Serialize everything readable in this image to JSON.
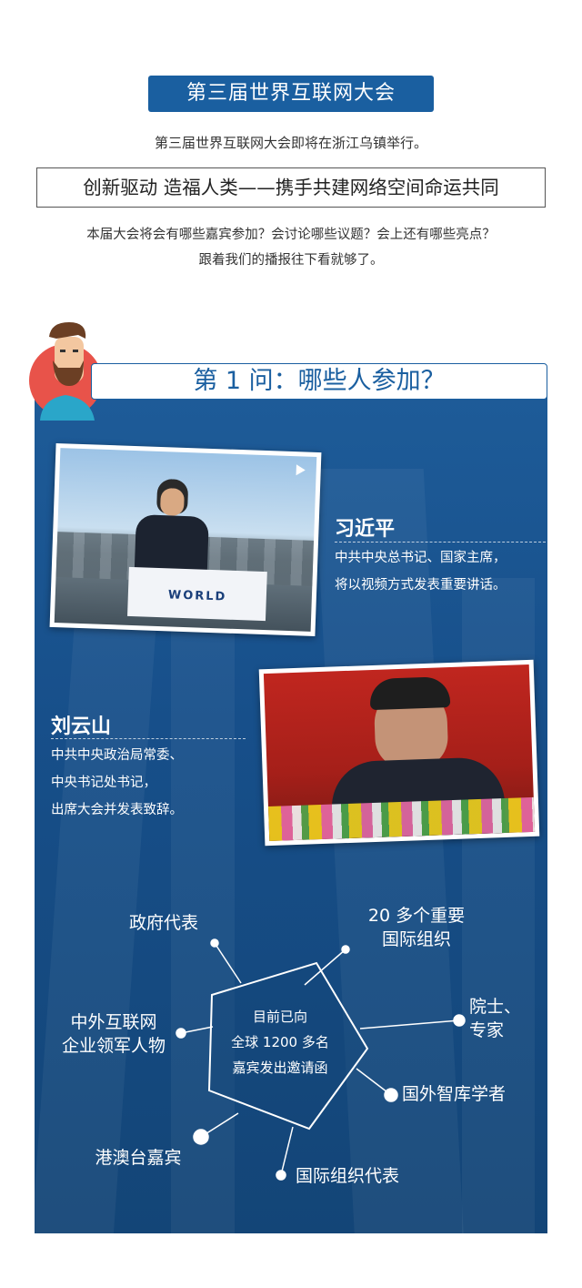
{
  "header": {
    "title": "第三届世界互联网大会",
    "intro": "第三届世界互联网大会即将在浙江乌镇举行。",
    "slogan": "创新驱动 造福人类——携手共建网络空间命运共同",
    "desc_line1": "本届大会将会有哪些嘉宾参加？会讨论哪些议题？会上还有哪些亮点？",
    "desc_line2": "跟着我们的播报往下看就够了。"
  },
  "section": {
    "question": "第 1 问：哪些人参加？"
  },
  "guests": [
    {
      "name": "习近平",
      "desc_line1": "中共中央总书记、国家主席，",
      "desc_line2": "将以视频方式发表重要讲话。",
      "photo_text": "WORLD"
    },
    {
      "name": "刘云山",
      "desc_line1": "中共中央政治局常委、",
      "desc_line2": "中央书记处书记，",
      "desc_line3": "出席大会并发表致辞。"
    }
  ],
  "diagram": {
    "center_line1": "目前已向",
    "center_line2": "全球 1200 多名",
    "center_line3": "嘉宾发出邀请函",
    "labels": {
      "gov": "政府代表",
      "intl_orgs_line1": "20 多个重要",
      "intl_orgs_line2": "国际组织",
      "academicians_line1": "院士、",
      "academicians_line2": "专家",
      "thinktank": "国外智库学者",
      "intl_reps": "国际组织代表",
      "hmt": "港澳台嘉宾",
      "leaders_line1": "中外互联网",
      "leaders_line2": "企业领军人物"
    }
  },
  "colors": {
    "brand_blue": "#1a5fa0",
    "panel_blue": "#174f8a"
  }
}
